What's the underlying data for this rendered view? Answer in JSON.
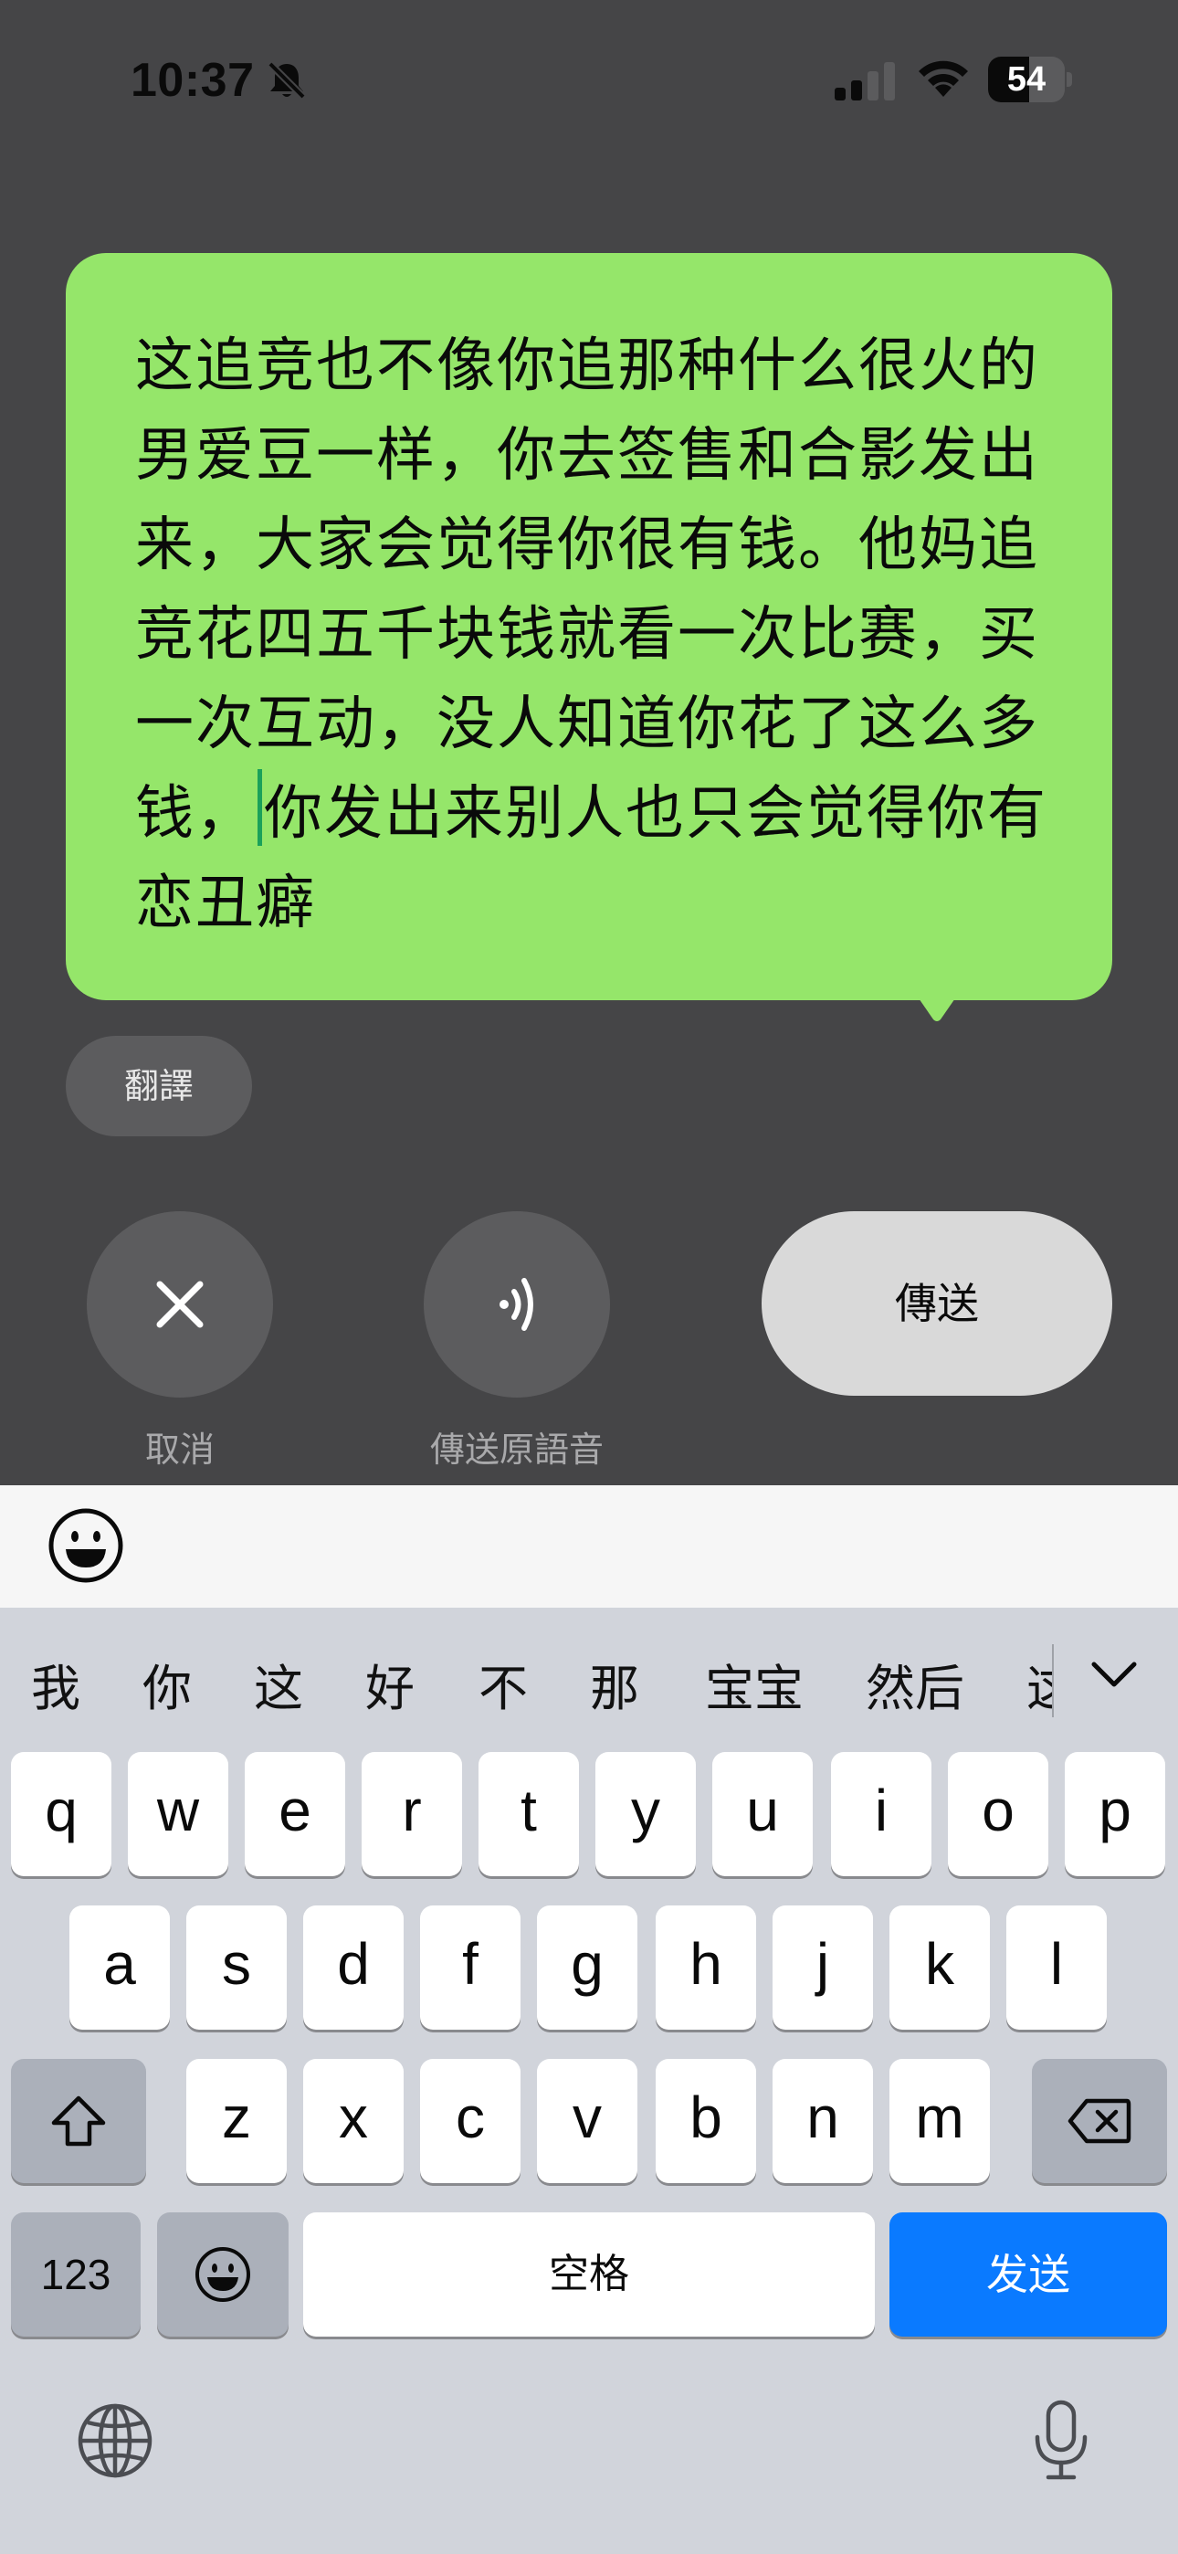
{
  "status_bar": {
    "time": "10:37",
    "battery_percent": "54",
    "battery_level": 0.54,
    "icons": [
      "bell-slash-icon",
      "cellular-signal-icon",
      "wifi-icon",
      "battery-icon"
    ]
  },
  "message": {
    "text_before_cursor": "这追竞也不像你追那种什么很火的男爱豆一样，你去签售和合影发出来，大家会觉得你很有钱。他妈追竞花四五千块钱就看一次比赛，买一次互动，没人知道你花了这么多钱，",
    "text_after_cursor": "你发出来别人也只会觉得你有恋丑癖",
    "bubble_color": "#95e66a"
  },
  "translate_label": "翻譯",
  "actions": {
    "cancel_label": "取消",
    "send_original_label": "傳送原語音",
    "send_label": "傳送"
  },
  "keyboard": {
    "candidates": [
      "我",
      "你",
      "这",
      "好",
      "不",
      "那",
      "宝宝",
      "然后",
      "这"
    ],
    "row1": [
      "q",
      "w",
      "e",
      "r",
      "t",
      "y",
      "u",
      "i",
      "o",
      "p"
    ],
    "row2": [
      "a",
      "s",
      "d",
      "f",
      "g",
      "h",
      "j",
      "k",
      "l"
    ],
    "row3": [
      "z",
      "x",
      "c",
      "v",
      "b",
      "n",
      "m"
    ],
    "numbers_label": "123",
    "space_label": "空格",
    "send_label": "发送",
    "send_color": "#0a7aff"
  }
}
